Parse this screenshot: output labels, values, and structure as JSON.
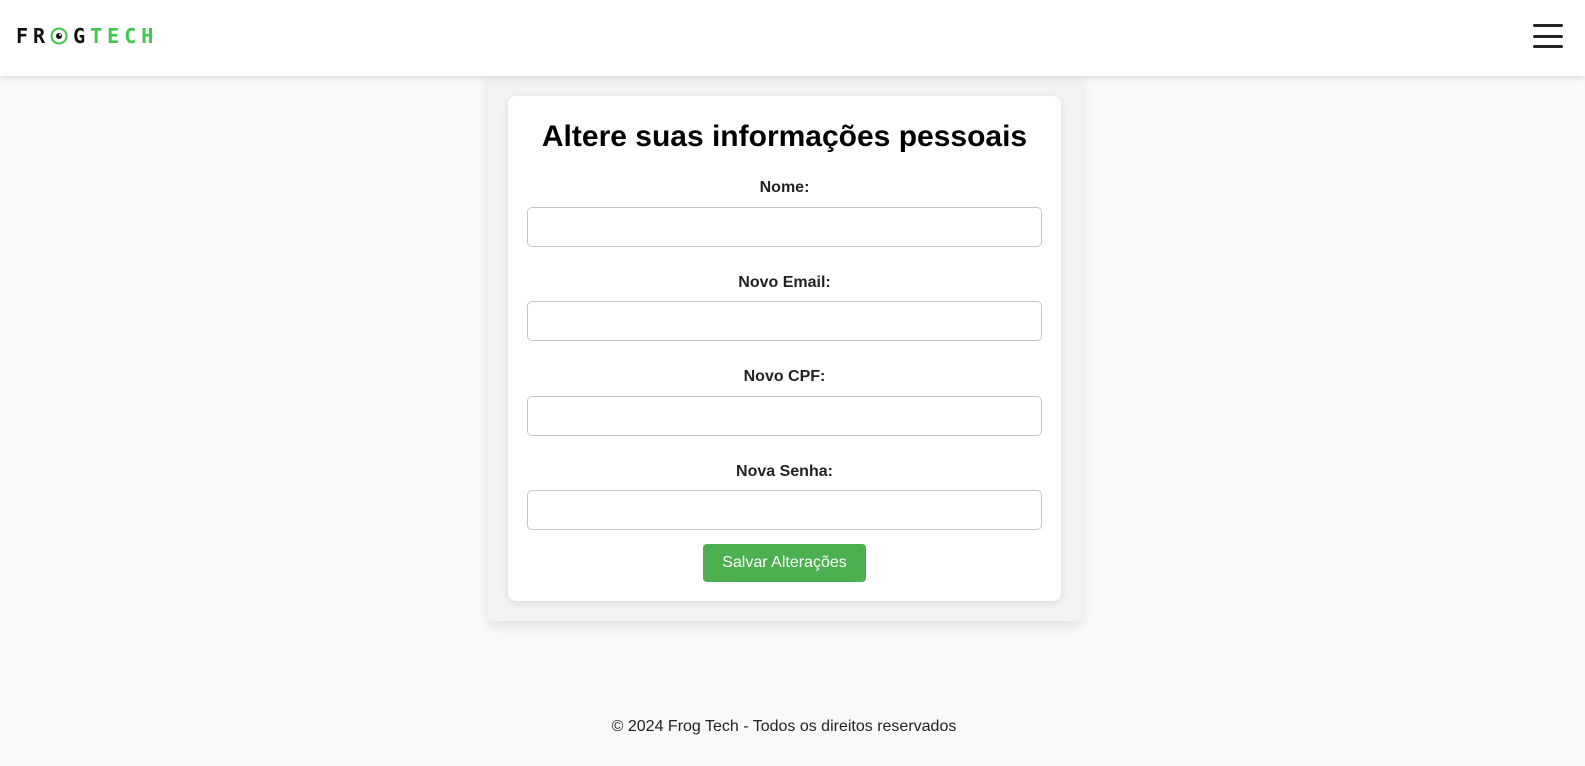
{
  "header": {
    "logo_part1": "FR",
    "logo_part2": "G",
    "logo_part3": "TECH",
    "menu_icon": "hamburger-menu-icon"
  },
  "colors": {
    "brand_green": "#3cc84a",
    "button_green": "#4caf50",
    "page_background": "#f9f9f9"
  },
  "form": {
    "title": "Altere suas informações pessoais",
    "fields": [
      {
        "label": "Nome:",
        "value": "",
        "placeholder": ""
      },
      {
        "label": "Novo Email:",
        "value": "",
        "placeholder": ""
      },
      {
        "label": "Novo CPF:",
        "value": "",
        "placeholder": ""
      },
      {
        "label": "Nova Senha:",
        "value": "",
        "placeholder": ""
      }
    ],
    "submit_label": "Salvar Alterações"
  },
  "footer": {
    "text": "© 2024 Frog Tech - Todos os direitos reservados"
  }
}
